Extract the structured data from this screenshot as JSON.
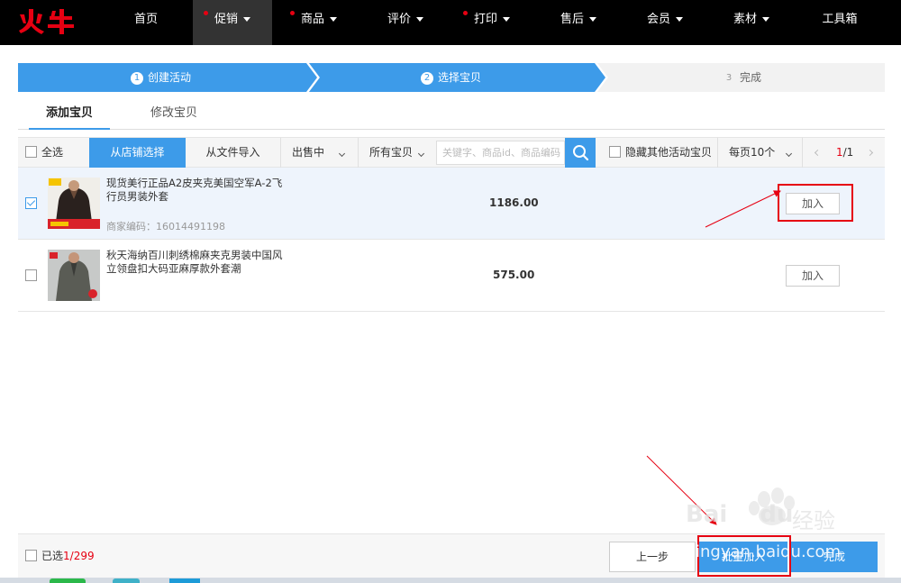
{
  "nav": {
    "logo_text": "火牛",
    "items": [
      {
        "label": "首页",
        "caret": false,
        "dot": false,
        "active": false
      },
      {
        "label": "促销",
        "caret": true,
        "dot": true,
        "active": true
      },
      {
        "label": "商品",
        "caret": true,
        "dot": true,
        "active": false
      },
      {
        "label": "评价",
        "caret": true,
        "dot": false,
        "active": false
      },
      {
        "label": "打印",
        "caret": true,
        "dot": true,
        "active": false
      },
      {
        "label": "售后",
        "caret": true,
        "dot": false,
        "active": false
      },
      {
        "label": "会员",
        "caret": true,
        "dot": false,
        "active": false
      },
      {
        "label": "素材",
        "caret": true,
        "dot": false,
        "active": false
      },
      {
        "label": "工具箱",
        "caret": false,
        "dot": false,
        "active": false
      }
    ]
  },
  "steps": [
    {
      "num": "1",
      "label": "创建活动",
      "state": "done"
    },
    {
      "num": "2",
      "label": "选择宝贝",
      "state": "done"
    },
    {
      "num": "3",
      "label": "完成",
      "state": "todo"
    }
  ],
  "tabs": {
    "add": "添加宝贝",
    "edit": "修改宝贝"
  },
  "toolbar": {
    "select_all": "全选",
    "from_shop": "从店铺选择",
    "from_file": "从文件导入",
    "status_filter": "出售中",
    "category_filter": "所有宝贝",
    "search_placeholder": "关键字、商品id、商品编码",
    "hide_others": "隐藏其他活动宝贝",
    "page_size": "每页10个",
    "page_current": "1",
    "page_total": "/1"
  },
  "products": [
    {
      "title": "现货美行正品A2皮夹克美国空军A-2飞行员男装外套",
      "code": "商家编码：16014491198",
      "price": "1186.00",
      "checked": true,
      "add_label": "加入"
    },
    {
      "title": "秋天海纳百川刺绣棉麻夹克男装中国风立领盘扣大码亚麻厚款外套潮",
      "code": "",
      "price": "575.00",
      "checked": false,
      "add_label": "加入"
    }
  ],
  "footer": {
    "selected_label": "已选",
    "selected_count": "1/299",
    "prev": "上一步",
    "batch_add": "批量加入",
    "finish": "完成"
  },
  "watermark": {
    "brand": "Bai",
    "brand2": "du",
    "cn": "经验",
    "url": "jingyan.baidu.com"
  },
  "colors": {
    "accent": "#3d9be9",
    "nav_bg": "#000000",
    "highlight": "#e60012"
  }
}
